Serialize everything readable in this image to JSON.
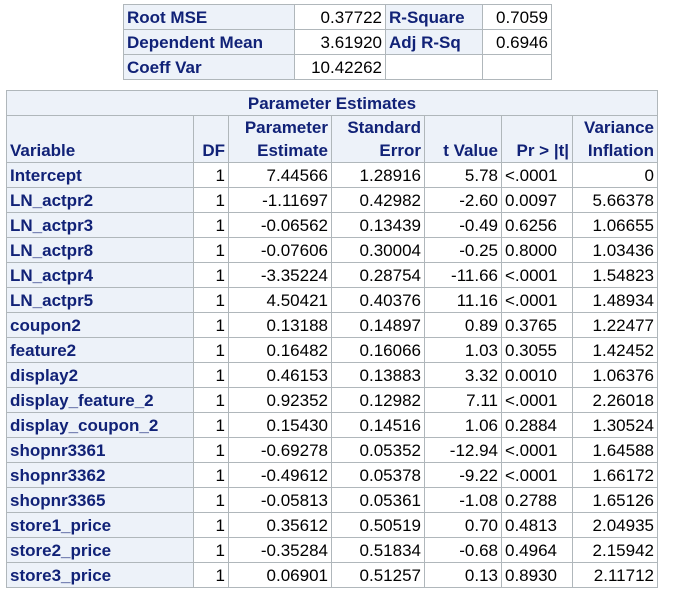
{
  "fit_statistics": {
    "rows": [
      {
        "label": "Root MSE",
        "value": "0.37722",
        "label2": "R-Square",
        "value2": "0.7059"
      },
      {
        "label": "Dependent Mean",
        "value": "3.61920",
        "label2": "Adj R-Sq",
        "value2": "0.6946"
      },
      {
        "label": "Coeff Var",
        "value": "10.42262",
        "label2": "",
        "value2": ""
      }
    ]
  },
  "parameter_estimates": {
    "title": "Parameter Estimates",
    "headers": {
      "variable": "Variable",
      "df": "DF",
      "estimate_line1": "Parameter",
      "estimate_line2": "Estimate",
      "stderr_line1": "Standard",
      "stderr_line2": "Error",
      "tvalue": "t Value",
      "prob": "Pr > |t|",
      "vif_line1": "Variance",
      "vif_line2": "Inflation"
    },
    "rows": [
      {
        "variable": "Intercept",
        "df": "1",
        "estimate": "7.44566",
        "stderr": "1.28916",
        "tvalue": "5.78",
        "prob": "<.0001",
        "vif": "0"
      },
      {
        "variable": "LN_actpr2",
        "df": "1",
        "estimate": "-1.11697",
        "stderr": "0.42982",
        "tvalue": "-2.60",
        "prob": "0.0097",
        "vif": "5.66378"
      },
      {
        "variable": "LN_actpr3",
        "df": "1",
        "estimate": "-0.06562",
        "stderr": "0.13439",
        "tvalue": "-0.49",
        "prob": "0.6256",
        "vif": "1.06655"
      },
      {
        "variable": "LN_actpr8",
        "df": "1",
        "estimate": "-0.07606",
        "stderr": "0.30004",
        "tvalue": "-0.25",
        "prob": "0.8000",
        "vif": "1.03436"
      },
      {
        "variable": "LN_actpr4",
        "df": "1",
        "estimate": "-3.35224",
        "stderr": "0.28754",
        "tvalue": "-11.66",
        "prob": "<.0001",
        "vif": "1.54823"
      },
      {
        "variable": "LN_actpr5",
        "df": "1",
        "estimate": "4.50421",
        "stderr": "0.40376",
        "tvalue": "11.16",
        "prob": "<.0001",
        "vif": "1.48934"
      },
      {
        "variable": "coupon2",
        "df": "1",
        "estimate": "0.13188",
        "stderr": "0.14897",
        "tvalue": "0.89",
        "prob": "0.3765",
        "vif": "1.22477"
      },
      {
        "variable": "feature2",
        "df": "1",
        "estimate": "0.16482",
        "stderr": "0.16066",
        "tvalue": "1.03",
        "prob": "0.3055",
        "vif": "1.42452"
      },
      {
        "variable": "display2",
        "df": "1",
        "estimate": "0.46153",
        "stderr": "0.13883",
        "tvalue": "3.32",
        "prob": "0.0010",
        "vif": "1.06376"
      },
      {
        "variable": "display_feature_2",
        "df": "1",
        "estimate": "0.92352",
        "stderr": "0.12982",
        "tvalue": "7.11",
        "prob": "<.0001",
        "vif": "2.26018"
      },
      {
        "variable": "display_coupon_2",
        "df": "1",
        "estimate": "0.15430",
        "stderr": "0.14516",
        "tvalue": "1.06",
        "prob": "0.2884",
        "vif": "1.30524"
      },
      {
        "variable": "shopnr3361",
        "df": "1",
        "estimate": "-0.69278",
        "stderr": "0.05352",
        "tvalue": "-12.94",
        "prob": "<.0001",
        "vif": "1.64588"
      },
      {
        "variable": "shopnr3362",
        "df": "1",
        "estimate": "-0.49612",
        "stderr": "0.05378",
        "tvalue": "-9.22",
        "prob": "<.0001",
        "vif": "1.66172"
      },
      {
        "variable": "shopnr3365",
        "df": "1",
        "estimate": "-0.05813",
        "stderr": "0.05361",
        "tvalue": "-1.08",
        "prob": "0.2788",
        "vif": "1.65126"
      },
      {
        "variable": "store1_price",
        "df": "1",
        "estimate": "0.35612",
        "stderr": "0.50519",
        "tvalue": "0.70",
        "prob": "0.4813",
        "vif": "2.04935"
      },
      {
        "variable": "store2_price",
        "df": "1",
        "estimate": "-0.35284",
        "stderr": "0.51834",
        "tvalue": "-0.68",
        "prob": "0.4964",
        "vif": "2.15942"
      },
      {
        "variable": "store3_price",
        "df": "1",
        "estimate": "0.06901",
        "stderr": "0.51257",
        "tvalue": "0.13",
        "prob": "0.8930",
        "vif": "2.11712"
      }
    ]
  },
  "colors": {
    "header_background": "#edf2f9",
    "header_text": "#112277",
    "border": "#b0b7bb"
  }
}
